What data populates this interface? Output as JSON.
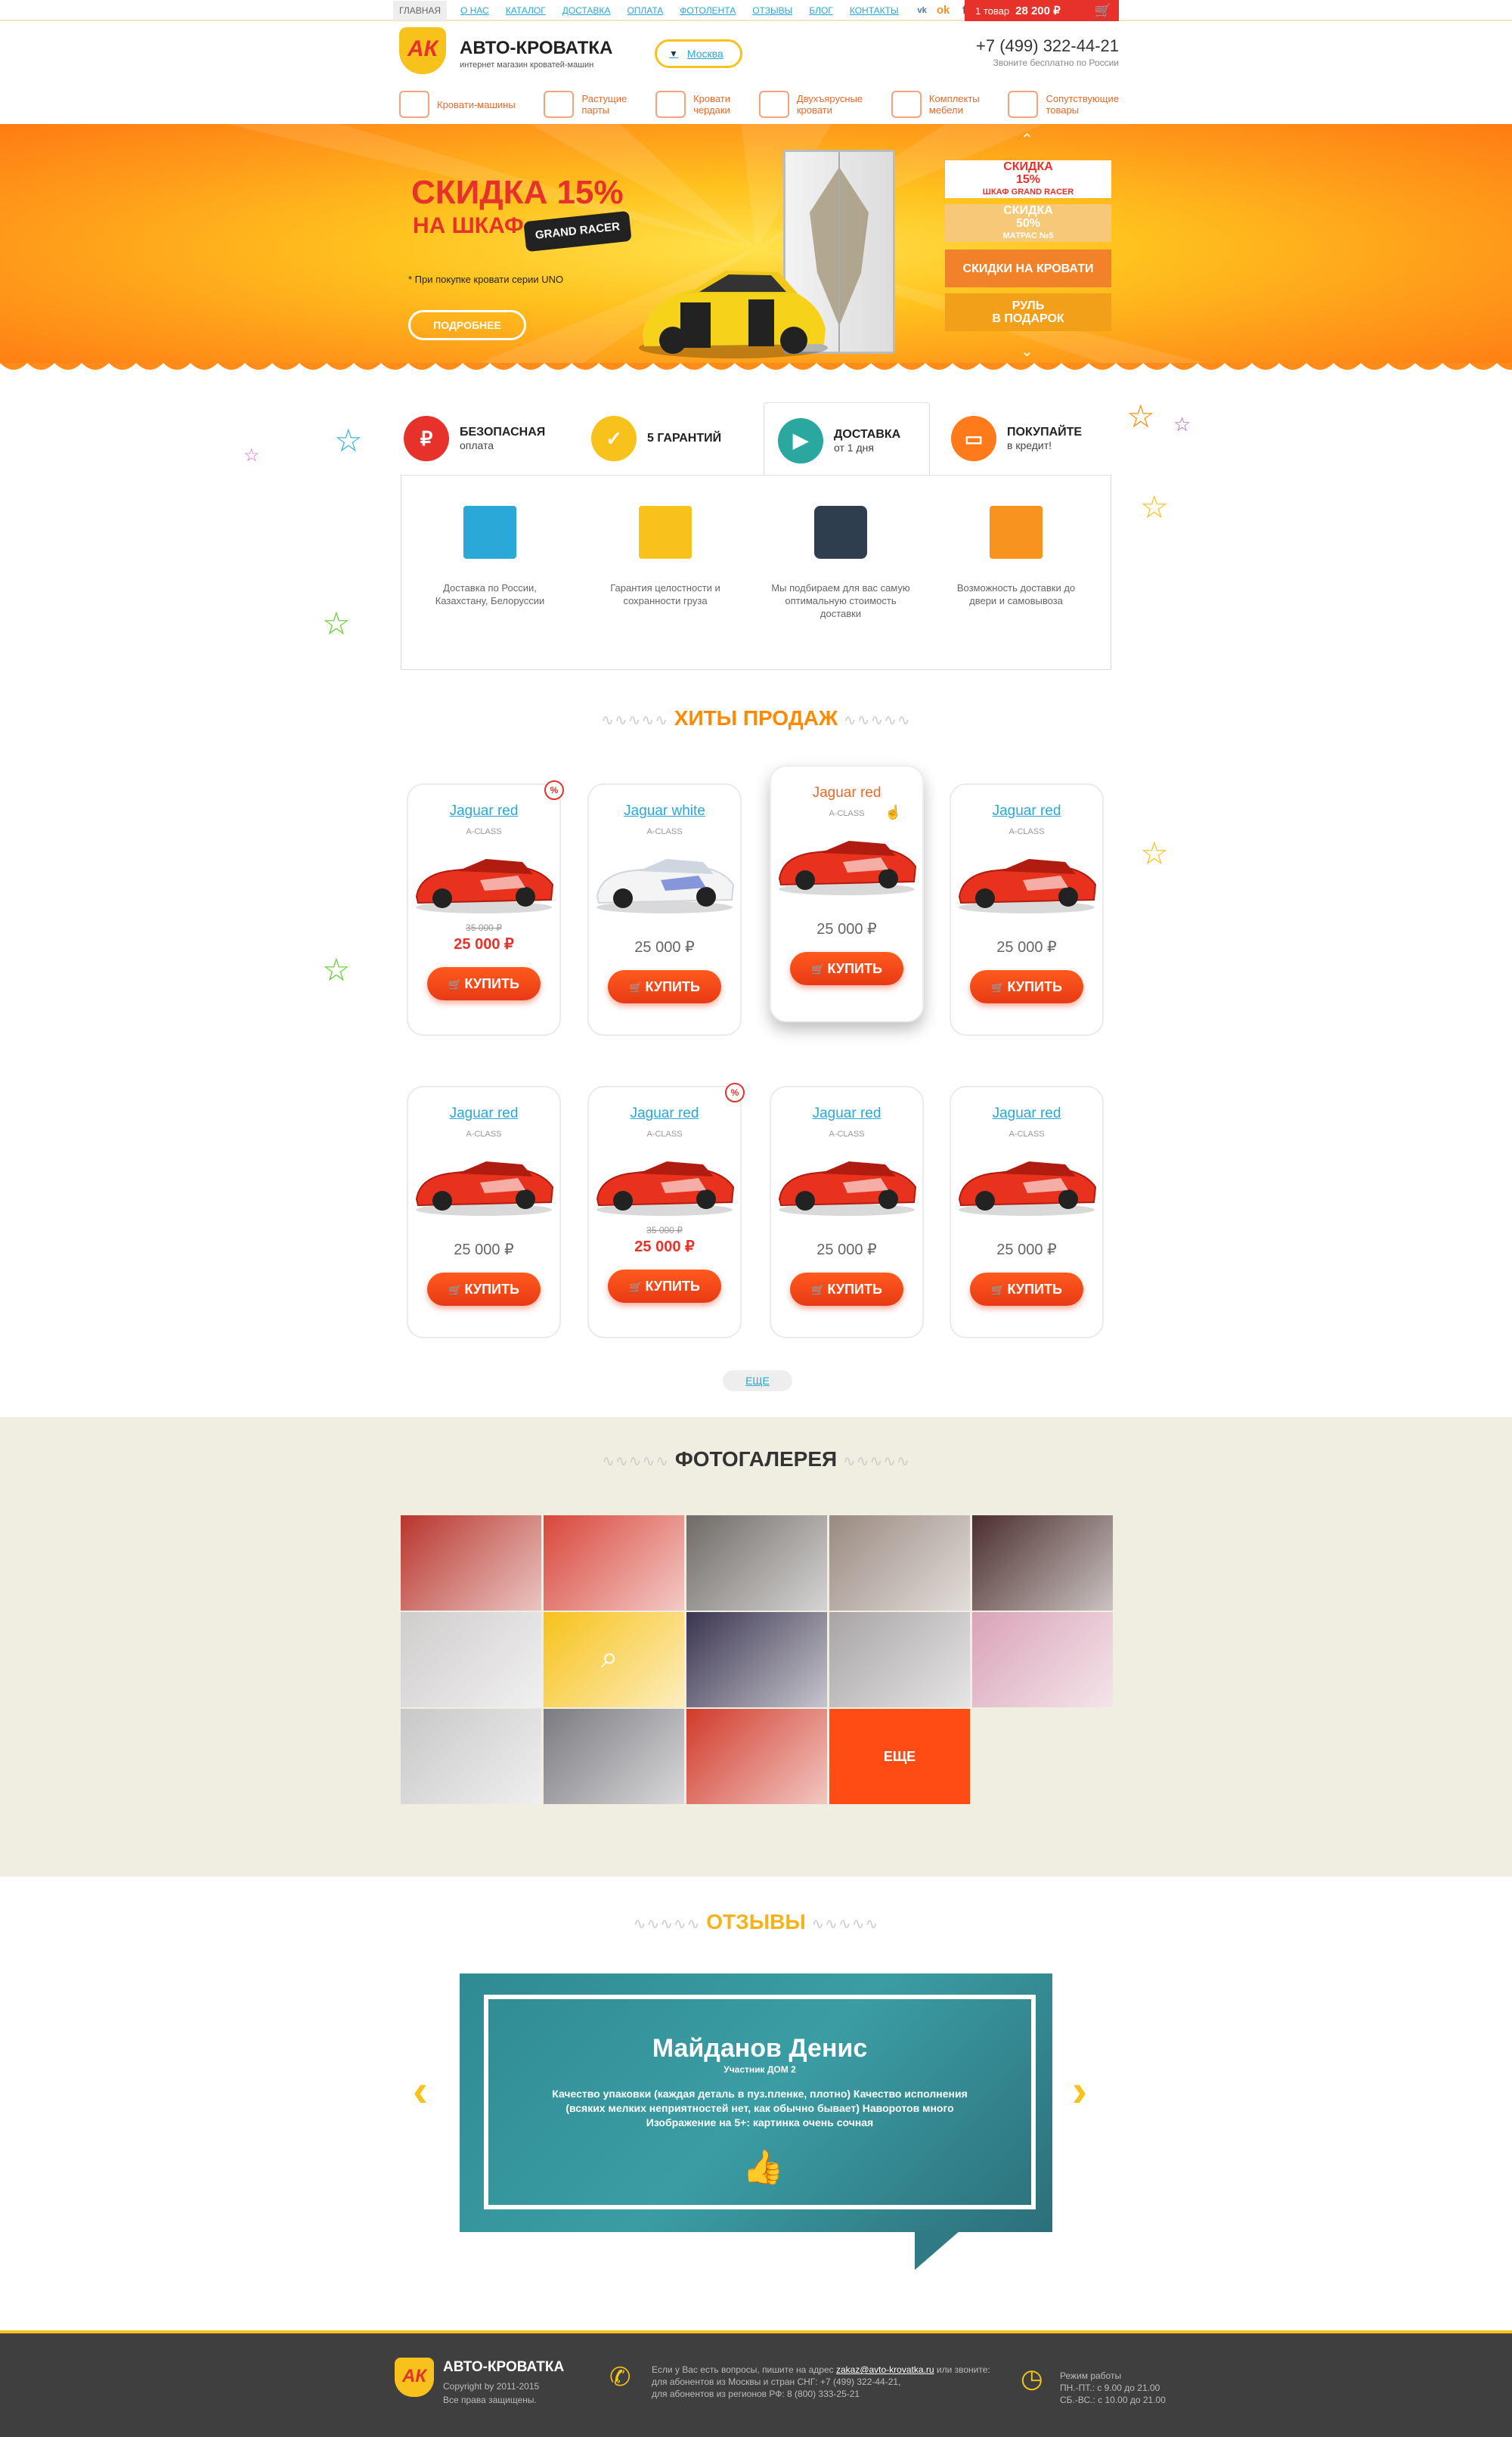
{
  "topnav": {
    "items": [
      "ГЛАВНАЯ",
      "О НАС",
      "КАТАЛОГ",
      "ДОСТАВКА",
      "ОПЛАТА",
      "ФОТОЛЕНТА",
      "ОТЗЫВЫ",
      "БЛОГ",
      "КОНТАКТЫ"
    ],
    "social": [
      "vk-icon",
      "odnoklassniki-icon",
      "facebook-icon",
      "instagram-icon"
    ]
  },
  "cart": {
    "count_label": "1 товар",
    "total": "28 200 ₽"
  },
  "header": {
    "logo_mark": "АК",
    "logo_title": "АВТО-КРОВАТКА",
    "logo_sub": "интернет магазин  кроватей-машин",
    "city": "Москва",
    "phone": "+7 (499) 322-44-21",
    "phone_note": "Звоните бесплатно по России"
  },
  "categories": [
    {
      "label": "Кровати-машины",
      "icon": "car-bed-icon"
    },
    {
      "label": "Растущие\nпарты",
      "icon": "desk-icon"
    },
    {
      "label": "Кровати\nчердаки",
      "icon": "loft-bed-icon"
    },
    {
      "label": "Двухъярусные\nкровати",
      "icon": "bunk-bed-icon"
    },
    {
      "label": "Комплекты\nмебели",
      "icon": "furniture-set-icon"
    },
    {
      "label": "Сопутствующие\nтовары",
      "icon": "accessories-icon"
    }
  ],
  "hero": {
    "title1": "СКИДКА 15%",
    "title2": "НА ШКАФ",
    "badge": "GRAND RACER",
    "note": "* При покупке  кровати серии UNO",
    "button": "ПОДРОБНЕЕ",
    "slides": [
      {
        "line1": "СКИДКА",
        "line2": "15%",
        "extra": "ШКАФ GRAND RACER"
      },
      {
        "line1": "СКИДКА",
        "line2": "50%",
        "extra": "МАТРАС №5"
      },
      {
        "line1": "СКИДКИ НА КРОВАТИ",
        "line2": "",
        "extra": ""
      },
      {
        "line1": "РУЛЬ",
        "line2": "В ПОДАРОК",
        "extra": ""
      }
    ],
    "colors": {
      "accent": "#e6322a",
      "yellow": "#f7c21b",
      "orange": "#ff8a00"
    }
  },
  "tabs": [
    {
      "title": "БЕЗОПАСНАЯ",
      "sub": "оплата",
      "icon": "safe-payment-icon"
    },
    {
      "title": "5 ГАРАНТИЙ",
      "sub": "",
      "icon": "guarantee-icon"
    },
    {
      "title": "ДОСТАВКА",
      "sub": "от 1 дня",
      "icon": "delivery-truck-icon"
    },
    {
      "title": "ПОКУПАЙТЕ",
      "sub": "в кредит!",
      "icon": "credit-card-icon"
    }
  ],
  "features": [
    {
      "text": "Доставка по России, Казахстану, Белоруссии",
      "icon": "map-pin-icon"
    },
    {
      "text": "Гарантия целостности и сохранности груза",
      "icon": "boxes-icon"
    },
    {
      "text": "Мы подбираем для вас самую оптимальную стоимость доставки",
      "icon": "calculator-icon"
    },
    {
      "text": "Возможность доставки до двери и самовывоза",
      "icon": "door-icon"
    }
  ],
  "hits": {
    "title": "ХИТЫ ПРОДАЖ",
    "buy_label": "КУПИТЬ",
    "more_label": "ЕЩЕ",
    "products": [
      {
        "name": "Jaguar red",
        "cls": "A-CLASS",
        "old": "35 000 ₽",
        "price": "25 000 ₽",
        "sale": true,
        "color": "red"
      },
      {
        "name": "Jaguar white",
        "cls": "A-CLASS",
        "old": "",
        "price": "25 000 ₽",
        "sale": false,
        "color": "white"
      },
      {
        "name": "Jaguar red",
        "cls": "A-CLASS",
        "old": "",
        "price": "25 000 ₽",
        "sale": false,
        "color": "red"
      },
      {
        "name": "Jaguar red",
        "cls": "A-CLASS",
        "old": "",
        "price": "25 000 ₽",
        "sale": false,
        "color": "red"
      },
      {
        "name": "Jaguar red",
        "cls": "A-CLASS",
        "old": "",
        "price": "25 000 ₽",
        "sale": false,
        "color": "red"
      },
      {
        "name": "Jaguar red",
        "cls": "A-CLASS",
        "old": "35 000 ₽",
        "price": "25 000 ₽",
        "sale": true,
        "color": "red"
      },
      {
        "name": "Jaguar red",
        "cls": "A-CLASS",
        "old": "",
        "price": "25 000 ₽",
        "sale": false,
        "color": "red"
      },
      {
        "name": "Jaguar red",
        "cls": "A-CLASS",
        "old": "",
        "price": "25 000 ₽",
        "sale": false,
        "color": "red"
      }
    ]
  },
  "gallery": {
    "title": "ФОТОГАЛЕРЕЯ",
    "more_label": "ЕЩЕ",
    "tiles": [
      "#b8352c",
      "#d8463a",
      "#6f6a66",
      "#9a8a80",
      "#4a2e2c",
      "#cfcccc",
      "#f7c21b",
      "#3a3450",
      "#a8a4a6",
      "#d9a3b7",
      "#c8c8c8",
      "#7a7a80",
      "#d13a2a"
    ]
  },
  "reviews": {
    "title": "ОТЗЫВЫ",
    "name": "Майданов Денис",
    "role": "Участник ДОМ 2",
    "text": "Качество упаковки (каждая деталь в пуз.пленке, плотно) Качество исполнения (всяких мелких неприятностей нет, как обычно бывает) Наворотов много Изображение на 5+: картинка очень сочная"
  },
  "footer": {
    "logo_title": "АВТО-КРОВАТКА",
    "copyright": "Copyright by  2011-2015",
    "rights": "Все права защищены.",
    "contact_line1": "Если у Вас есть вопросы, пишите на адрес",
    "email": "zakaz@avto-krovatka.ru",
    "contact_line1b": "или звоните:",
    "contact_line2": "для абонентов из Москвы и стран СНГ: +7 (499) 322-44-21,",
    "contact_line3": "для абонентов из регионов РФ: 8 (800) 333-25-21",
    "hours_title": "Режим работы",
    "hours_1": "ПН.-ПТ.: с 9.00 до 21.00",
    "hours_2": "СБ.-ВС.: с 10.00 до 21.00"
  }
}
